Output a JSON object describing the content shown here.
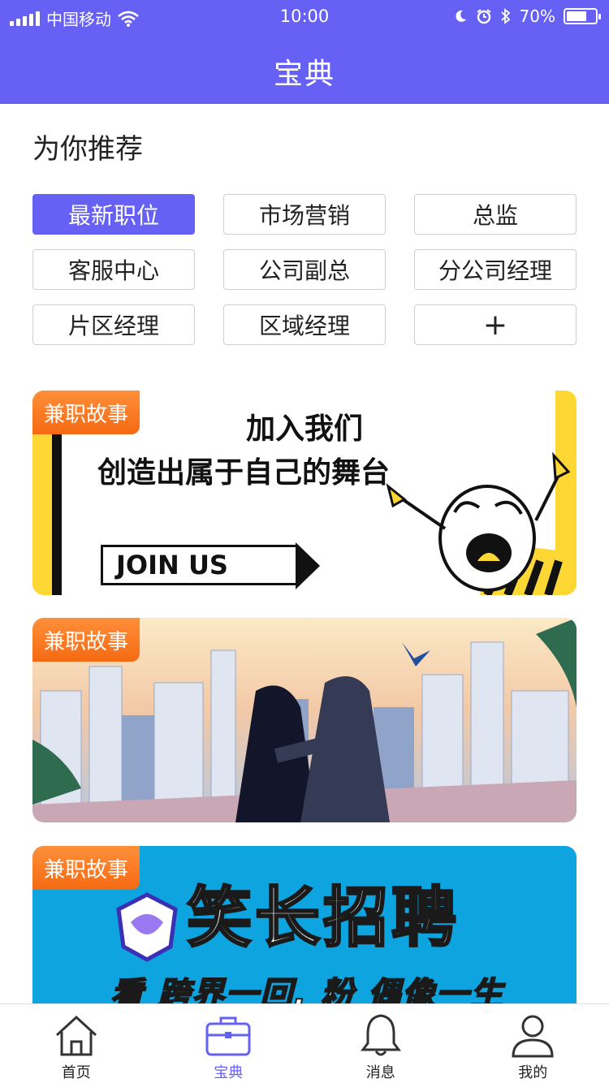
{
  "status_bar": {
    "carrier": "中国移动",
    "time": "10:00",
    "battery_text": "70%",
    "battery_level": 0.7
  },
  "header": {
    "title": "宝典"
  },
  "recommend": {
    "title": "为你推荐",
    "tags": [
      "最新职位",
      "市场营销",
      "总监",
      "客服中心",
      "公司副总",
      "分公司经理",
      "片区经理",
      "区域经理",
      "+"
    ],
    "active_index": 0
  },
  "banners": [
    {
      "badge": "兼职故事",
      "line1": "加入我们",
      "line2": "创造出属于自己的舞台",
      "cta": "JOIN  US"
    },
    {
      "badge": "兼职故事"
    },
    {
      "badge": "兼职故事",
      "headline": "笑长招聘",
      "subline": "看 跨界一回, 粉 偶像一生"
    }
  ],
  "tabbar": {
    "items": [
      {
        "label": "首页",
        "icon": "home-icon"
      },
      {
        "label": "宝典",
        "icon": "briefcase-icon"
      },
      {
        "label": "消息",
        "icon": "bell-icon"
      },
      {
        "label": "我的",
        "icon": "user-icon"
      }
    ],
    "active_index": 1
  },
  "colors": {
    "primary": "#6760f4",
    "badge": "#f56a12"
  }
}
